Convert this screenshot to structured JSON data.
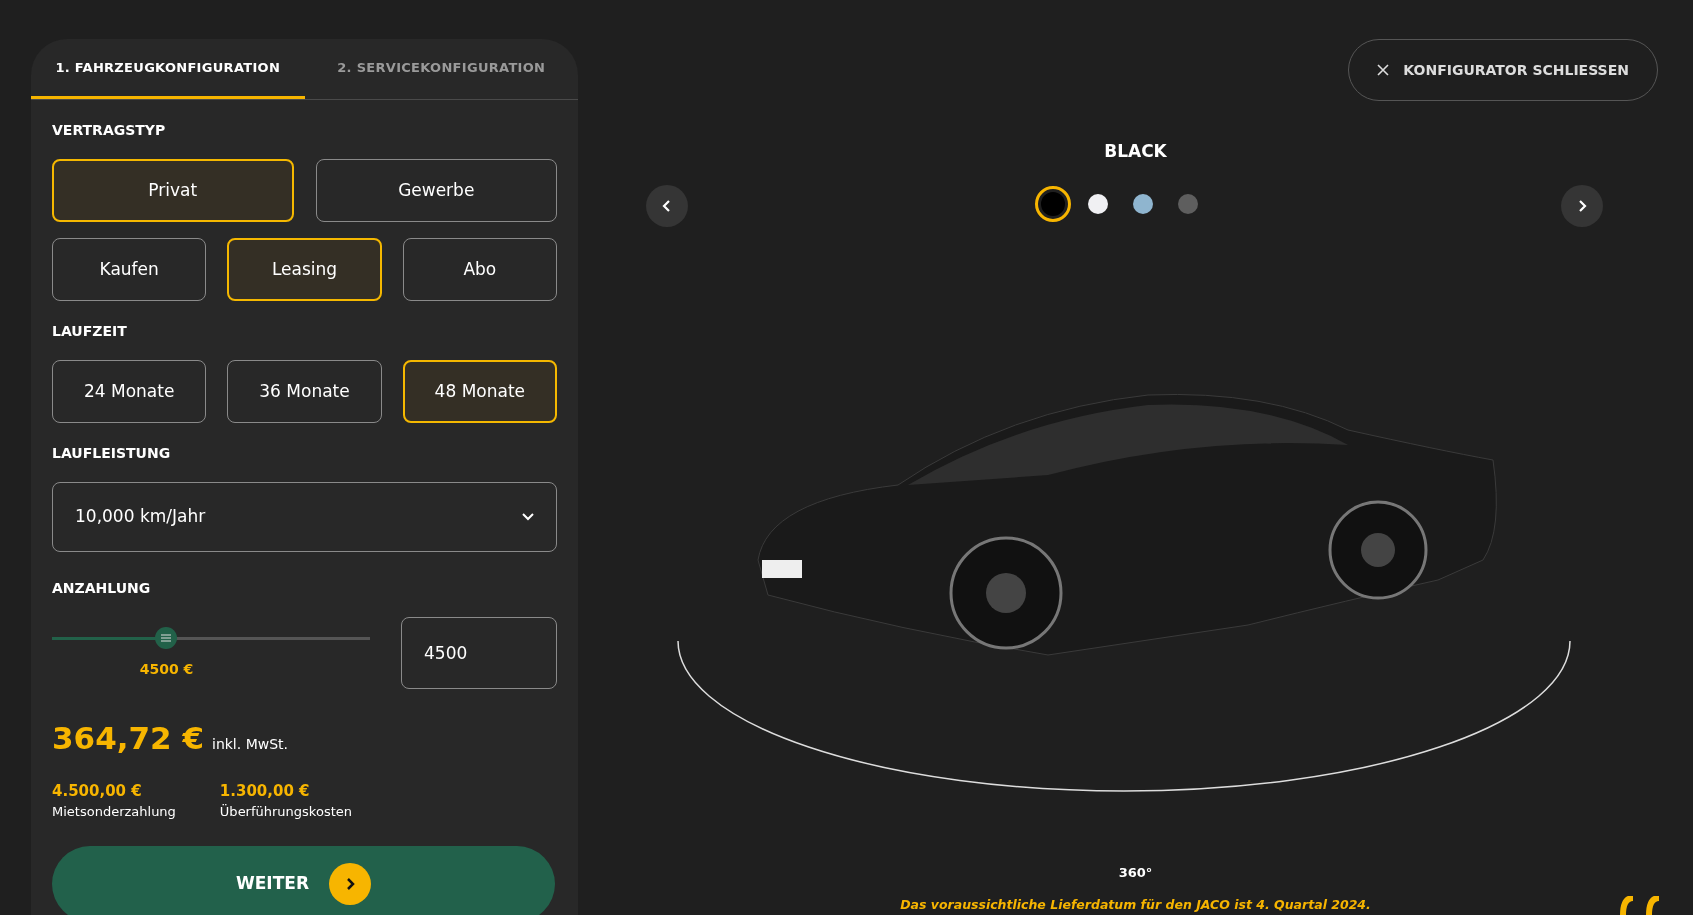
{
  "tabs": [
    {
      "label": "1. FAHRZEUGKONFIGURATION",
      "selected": true
    },
    {
      "label": "2. SERVICEKONFIGURATION",
      "selected": false
    }
  ],
  "contract_type": {
    "heading": "VERTRAGSTYP",
    "customer_options": [
      {
        "label": "Privat",
        "selected": true
      },
      {
        "label": "Gewerbe",
        "selected": false
      }
    ],
    "purchase_options": [
      {
        "label": "Kaufen",
        "selected": false
      },
      {
        "label": "Leasing",
        "selected": true
      },
      {
        "label": "Abo",
        "selected": false
      }
    ]
  },
  "term": {
    "heading": "LAUFZEIT",
    "options": [
      {
        "label": "24 Monate",
        "selected": false
      },
      {
        "label": "36 Monate",
        "selected": false
      },
      {
        "label": "48 Monate",
        "selected": true
      }
    ]
  },
  "mileage": {
    "heading": "LAUFLEISTUNG",
    "value": "10,000 km/Jahr"
  },
  "down_payment": {
    "heading": "ANZAHLUNG",
    "level": 0.36,
    "reading": "4500 €",
    "value": "4500"
  },
  "price": {
    "amount": "364,72 €",
    "note": "inkl. MwSt."
  },
  "costs": [
    {
      "amount": "4.500,00 €",
      "label": "Mietsonderzahlung"
    },
    {
      "amount": "1.300,00 €",
      "label": "Überführungskosten"
    }
  ],
  "next_button": "WEITER",
  "close_button": "KONFIGURATOR SCHLIESSEN",
  "color_name": "BLACK",
  "colors": [
    {
      "color": "#000000",
      "selected": true
    },
    {
      "color": "#f0f0f3",
      "selected": false
    },
    {
      "color": "#8fb5cf",
      "selected": false
    },
    {
      "color": "#5e5e5e",
      "selected": false
    }
  ],
  "view_label": "360°",
  "delivery_note": "Das voraussichtliche Lieferdatum für den JACO ist 4. Quartal 2024."
}
